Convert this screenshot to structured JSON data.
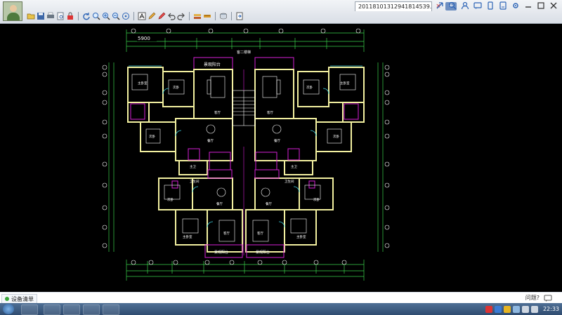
{
  "window": {
    "file_tab": "20118101312941814539.d...",
    "tab_close": "×",
    "new_tab": "+"
  },
  "toolbar": {
    "items": [
      "open-icon",
      "save-icon",
      "print-icon",
      "print-preview-icon",
      "lock-icon",
      "rotate-icon",
      "zoom-window-icon",
      "zoom-in-icon",
      "zoom-out-icon",
      "pan-icon",
      "text-icon",
      "pencil-icon",
      "highlighter-icon",
      "undo-icon",
      "redo-icon",
      "layer-icon",
      "measure-icon",
      "stack-icon",
      "export-icon"
    ]
  },
  "drawing": {
    "top_dim": "5900",
    "balcony_top": "景观阳台",
    "stair_label": "客二楼梯",
    "bottom_balcony_left": "景观阳台",
    "bottom_balcony_right": "景观阳台",
    "rooms_left": [
      "主卧室",
      "次卧",
      "客厅",
      "次卧",
      "餐厅",
      "主卫",
      "卫生间",
      "次卧",
      "餐厅",
      "客厅",
      "主卧室"
    ],
    "rooms_right": [
      "主卧室",
      "次卧",
      "客厅",
      "次卧",
      "餐厅",
      "主卫",
      "卫生间",
      "次卧",
      "餐厅",
      "客厅",
      "主卧室"
    ]
  },
  "statusbar": {
    "device_label": "设备清单",
    "feedback": "问题?"
  },
  "taskbar": {
    "clock": "22:33"
  },
  "colors": {
    "wall": "#f2f0a0",
    "dimension": "#39d14a",
    "accent": "#d61fd6",
    "axis": "#ffffff",
    "annotation": "#3fd6e6"
  }
}
